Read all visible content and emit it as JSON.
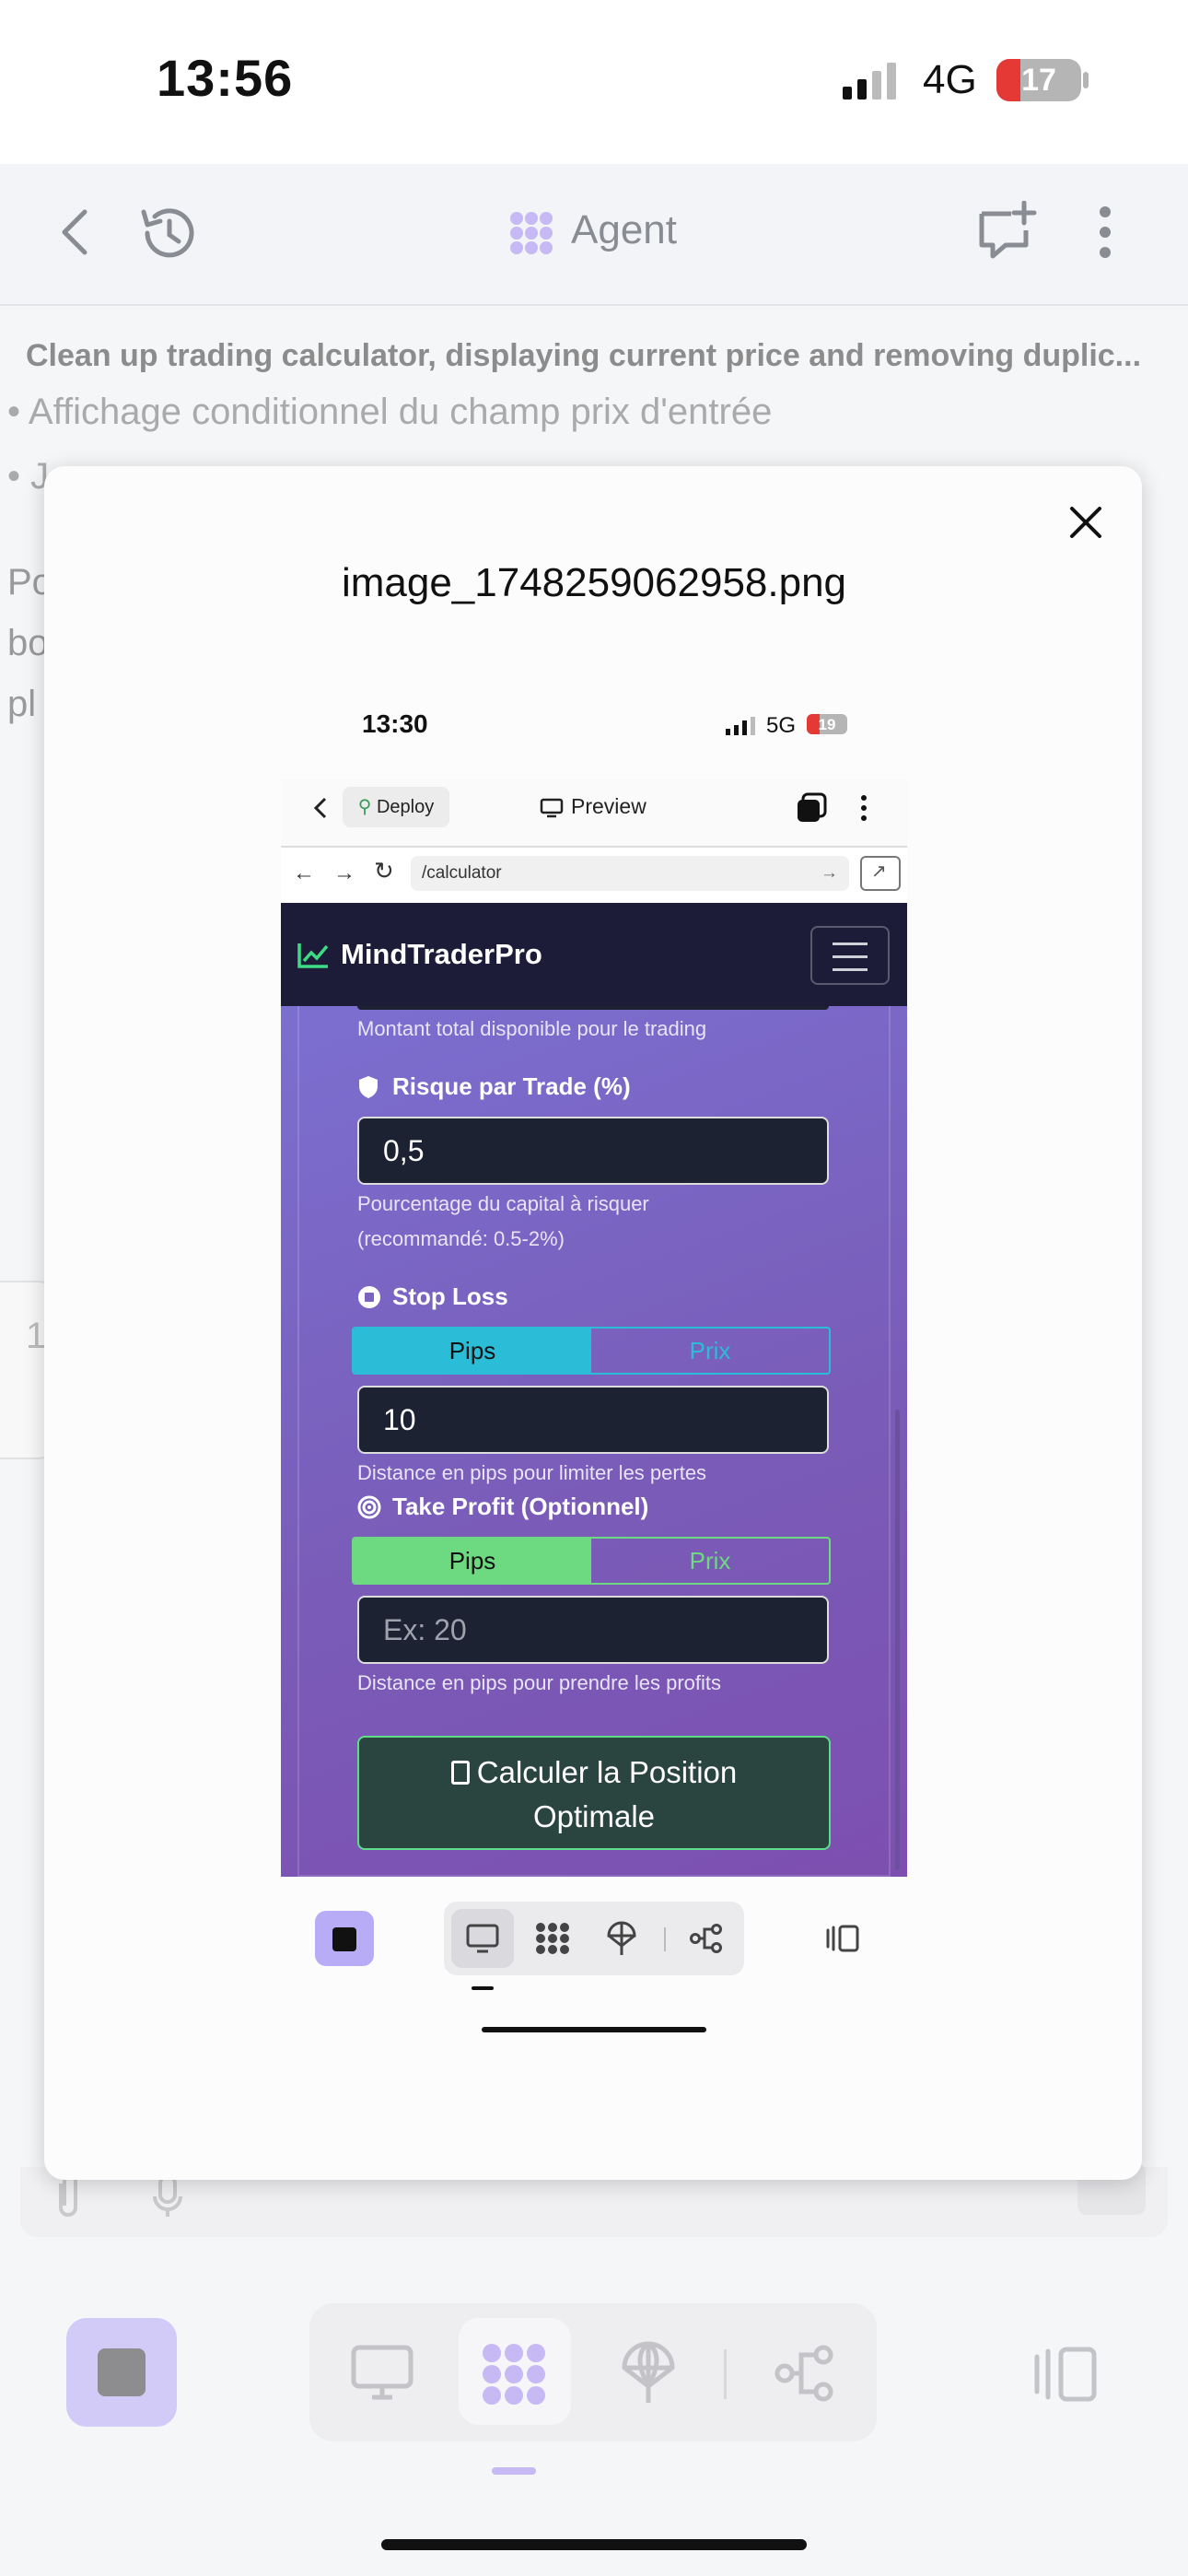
{
  "status_bar": {
    "time": "13:56",
    "network": "4G",
    "battery": "17"
  },
  "header": {
    "title": "Agent"
  },
  "chat": {
    "title": "Clean up trading calculator, displaying current price and removing duplic...",
    "bullet1": "• Affichage conditionnel du champ prix d'entrée",
    "bullet2": "• J",
    "frag_po": "Po",
    "frag_bo": "bo",
    "frag_pl": "pl",
    "frag_1": "1"
  },
  "modal": {
    "title": "image_1748259062958.png"
  },
  "inner": {
    "status": {
      "time": "13:30",
      "network": "5G",
      "battery": "19"
    },
    "toolbar": {
      "deploy": "Deploy",
      "preview": "Preview"
    },
    "url": "/calculator",
    "brand": "MindTraderPro",
    "capital_help": "Montant total disponible pour le trading",
    "risk": {
      "label": "Risque par Trade (%)",
      "value": "0,5",
      "help1": "Pourcentage du capital à risquer",
      "help2": "(recommandé: 0.5-2%)"
    },
    "stop_loss": {
      "label": "Stop Loss",
      "tab_pips": "Pips",
      "tab_prix": "Prix",
      "value": "10",
      "help": "Distance en pips pour limiter les pertes"
    },
    "take_profit": {
      "label": "Take Profit (Optionnel)",
      "tab_pips": "Pips",
      "tab_prix": "Prix",
      "placeholder": "Ex: 20",
      "help": "Distance en pips pour prendre les profits"
    },
    "calc_button_line1": "Calculer la Position",
    "calc_button_line2": "Optimale"
  },
  "colors": {
    "accent": "#b9acf6",
    "sl_active": "#2bbcd8",
    "tp_active": "#6dd980",
    "nav_bg": "#1d1c38"
  }
}
